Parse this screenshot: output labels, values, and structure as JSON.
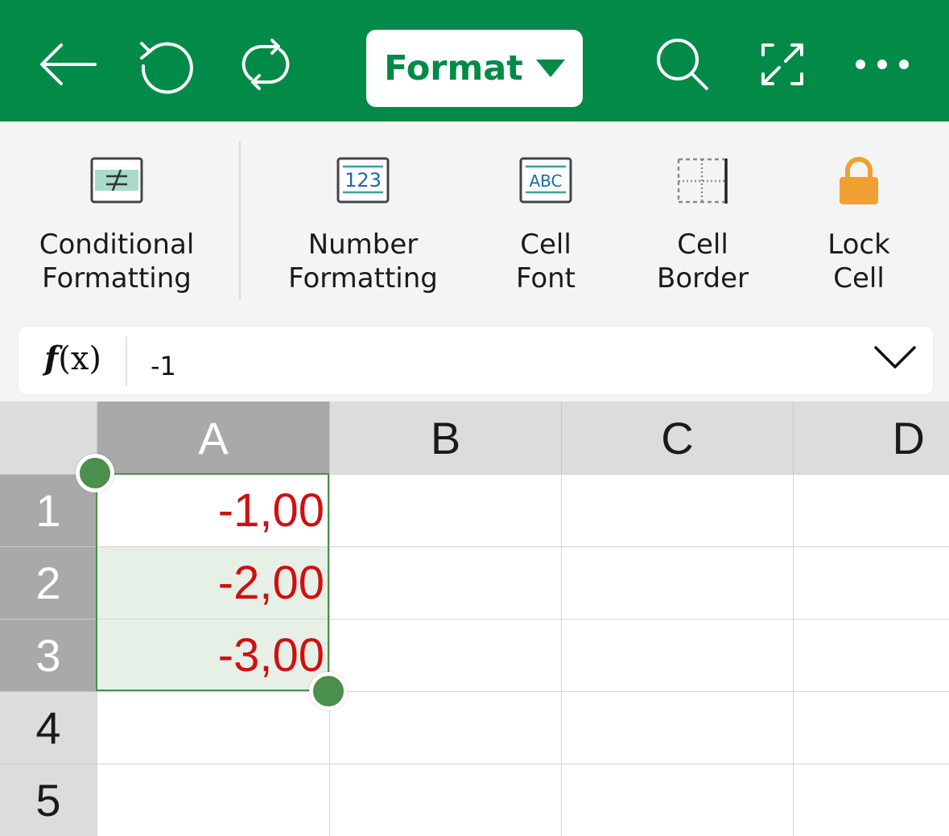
{
  "toolbar": {
    "format_label": "Format",
    "icons": [
      "back-arrow-icon",
      "undo-icon",
      "sync-icon",
      "search-icon",
      "fullscreen-icon",
      "more-icon"
    ]
  },
  "ribbon": {
    "items": [
      {
        "line1": "Conditional",
        "line2": "Formatting",
        "icon": "conditional-formatting-icon"
      },
      {
        "line1": "Number",
        "line2": "Formatting",
        "icon": "number-formatting-icon",
        "icon_text": "123"
      },
      {
        "line1": "Cell",
        "line2": "Font",
        "icon": "cell-font-icon",
        "icon_text": "ABC"
      },
      {
        "line1": "Cell",
        "line2": "Border",
        "icon": "cell-border-icon"
      },
      {
        "line1": "Lock",
        "line2": "Cell",
        "icon": "lock-icon"
      }
    ]
  },
  "formula_bar": {
    "fx_f": "f",
    "fx_x": "(x)",
    "value": "-1"
  },
  "sheet": {
    "columns": [
      "A",
      "B",
      "C",
      "D"
    ],
    "rows": [
      "1",
      "2",
      "3",
      "4",
      "5"
    ],
    "cells": {
      "A1": "-1,00",
      "A2": "-2,00",
      "A3": "-3,00"
    },
    "selection": "A1:A3"
  },
  "colors": {
    "brand_green": "#028a48",
    "negative_red": "#d01010",
    "selection_green": "#4a8f4c",
    "lock_orange": "#f0a030"
  }
}
